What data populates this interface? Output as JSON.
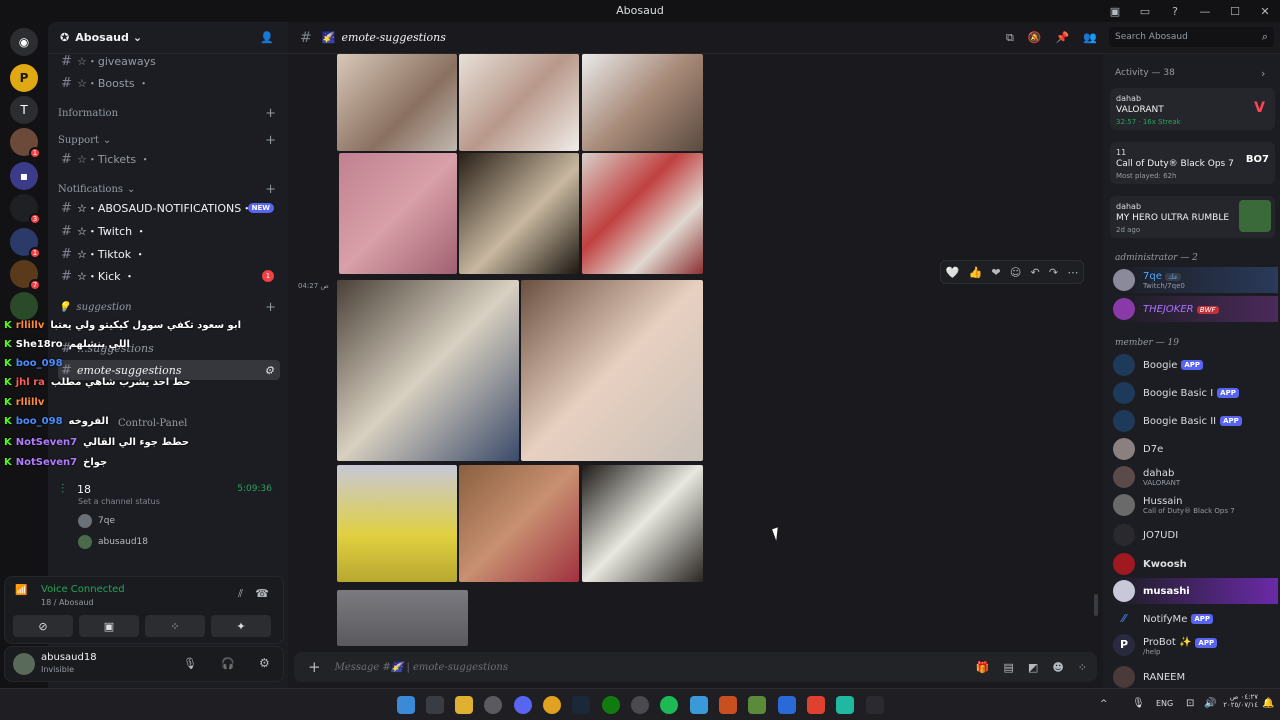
{
  "window": {
    "title": "Abosaud"
  },
  "server": {
    "name": "Abosaud"
  },
  "sidebar": {
    "channels_top": [
      {
        "label": "☆・giveaways"
      },
      {
        "label": "☆・Boosts ・"
      }
    ],
    "categories": [
      {
        "label": "Information"
      },
      {
        "label": "Support"
      },
      {
        "label": "Notifications"
      },
      {
        "label": "suggestion"
      },
      {
        "label": "Control-Panel"
      }
    ],
    "support_channels": [
      {
        "label": "☆・Tickets ・"
      }
    ],
    "notif_channels": [
      {
        "label": "☆・ABOSAUD-NOTIFICATIONS・",
        "badge": "NEW"
      },
      {
        "label": "☆・Twitch ・"
      },
      {
        "label": "☆・Tiktok ・"
      },
      {
        "label": "☆・Kick ・",
        "count": "1"
      }
    ],
    "suggestion_channels": [
      {
        "label": "...suggestions"
      },
      {
        "label": "emote-suggestions"
      }
    ],
    "voice": {
      "channel": "18",
      "status": "Set a channel status",
      "timer": "5:09:36",
      "users": [
        {
          "name": "7qe"
        },
        {
          "name": "abusaud18"
        }
      ]
    }
  },
  "overlay_chat": [
    {
      "user": "rllillv",
      "text": "ابو سعود تكفي سوول كيكيتو ولي يعتبا",
      "color": "#ff8a3d"
    },
    {
      "user": "She18ro",
      "text": "اللي ينشلهم",
      "color": "#ffffff"
    },
    {
      "user": "boo_098",
      "text": "",
      "color": "#4a8cff"
    },
    {
      "user": "jhl ra",
      "text": "حط احد يشرب شاهي مطلب",
      "color": "#ff5b5b"
    },
    {
      "user": "rllillv",
      "text": "",
      "color": "#ff8a3d"
    },
    {
      "user": "boo_098",
      "text": "الفروخه",
      "color": "#4a8cff"
    },
    {
      "user": "NotSeven7",
      "text": "حطط جوء الي القالي",
      "color": "#b07cff"
    },
    {
      "user": "NotSeven7",
      "text": "جواخ",
      "color": "#b07cff"
    }
  ],
  "voice_panel": {
    "title": "Voice Connected",
    "sub": "18 / Abosaud"
  },
  "user_panel": {
    "name": "abusaud18",
    "status": "Invisible"
  },
  "channel_header": {
    "name": "emote-suggestions",
    "search_placeholder": "Search Abosaud"
  },
  "messages": {
    "timestamp": "04:27 ص"
  },
  "message_input": {
    "placeholder": "Message #🌠 | emote-suggestions"
  },
  "members": {
    "activity_header": "Activity — 38",
    "activities": [
      {
        "user": "dahab",
        "game": "VALORANT",
        "meta": "32:57 · 16x Streak"
      },
      {
        "user": "11",
        "game": "Call of Duty® Black Ops 7",
        "meta": "Most played: 62h"
      },
      {
        "user": "dahab",
        "game": "MY HERO ULTRA RUMBLE",
        "meta": "2d ago"
      }
    ],
    "admin_header": "administrator — 2",
    "admins": [
      {
        "name": "7qe",
        "tag": "عك",
        "sub": "Twitch/7qe0"
      },
      {
        "name": "THEJOKER",
        "tag": "BWF"
      }
    ],
    "member_header": "member — 19",
    "list": [
      {
        "name": "Boogie",
        "app": "APP"
      },
      {
        "name": "Boogie Basic I",
        "app": "APP"
      },
      {
        "name": "Boogie Basic II",
        "app": "APP"
      },
      {
        "name": "D7e"
      },
      {
        "name": "dahab",
        "sub": "VALORANT"
      },
      {
        "name": "Hussain",
        "sub": "Call of Duty® Black Ops 7"
      },
      {
        "name": "JO7UDI"
      },
      {
        "name": "Kwoosh"
      },
      {
        "name": "musashi"
      },
      {
        "name": "NotifyMe",
        "app": "APP"
      },
      {
        "name": "ProBot ✨",
        "app": "APP",
        "sub": "/help"
      },
      {
        "name": "RANEEM"
      }
    ]
  },
  "taskbar": {
    "lang": "ENG",
    "time": "٠٤:٢٧ ص",
    "date": "٢٠٢٥/٠٧/١٤"
  }
}
